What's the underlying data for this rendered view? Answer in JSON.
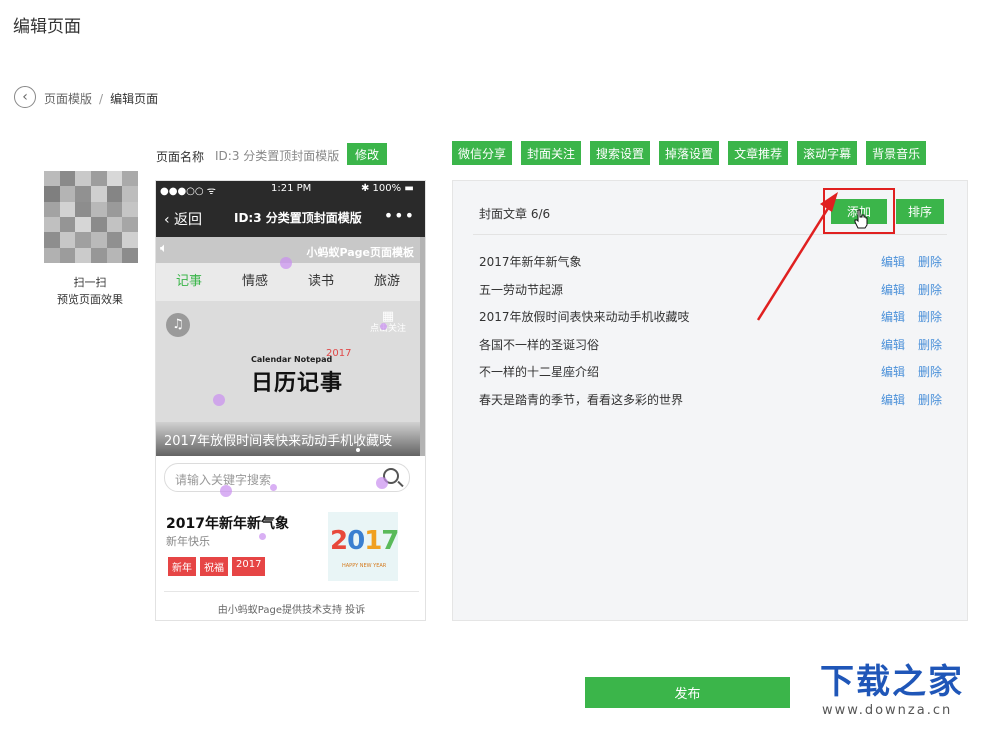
{
  "page_title": "编辑页面",
  "breadcrumb": {
    "parent": "页面模版",
    "separator": "/",
    "current": "编辑页面"
  },
  "preview": {
    "scan_label": "扫一扫",
    "preview_label": "预览页面效果"
  },
  "page_name": {
    "label": "页面名称",
    "value": "ID:3 分类置顶封面模版",
    "modify_label": "修改"
  },
  "toolbar": [
    "微信分享",
    "封面关注",
    "搜索设置",
    "掉落设置",
    "文章推荐",
    "滚动字幕",
    "背景音乐"
  ],
  "phone": {
    "carrier": "●●●○○ ᯤ",
    "time": "1:21 PM",
    "battery": "✱ 100% ▬",
    "back_label": "‹ 返回",
    "title": "ID:3 分类置顶封面模版",
    "more": "•••",
    "brand": "小蚂蚁Page页面模板",
    "tabs": [
      "记事",
      "情感",
      "读书",
      "旅游"
    ],
    "follow_label": "点击关注",
    "calendar_small": "Calendar Notepad",
    "calendar_year": "2017",
    "calendar_big": "日历记事",
    "hero_caption": "2017年放假时间表快来动动手机收藏吱",
    "search_placeholder": "请输入关键字搜索",
    "article_title": "2017年新年新气象",
    "article_subtitle": "新年快乐",
    "article_tags": [
      "新年",
      "祝福",
      "2017"
    ],
    "thumb_year": "2017",
    "thumb_caption": "HAPPY NEW YEAR",
    "footer": "由小蚂蚁Page提供技术支持 投诉"
  },
  "panel": {
    "heading": "封面文章  6/6",
    "add_label": "添加",
    "sort_label": "排序",
    "edit_label": "编辑",
    "delete_label": "删除",
    "articles": [
      "2017年新年新气象",
      "五一劳动节起源",
      "2017年放假时间表快来动动手机收藏吱",
      "各国不一样的圣诞习俗",
      "不一样的十二星座介绍",
      "春天是踏青的季节，看看这多彩的世界"
    ]
  },
  "publish_label": "发布",
  "watermark": {
    "title": "下载之家",
    "url": "www.downza.cn"
  },
  "colors": {
    "accent": "#3bb54a",
    "link": "#4a90d9",
    "highlight": "#e02020",
    "watermark": "#1f56b8"
  }
}
